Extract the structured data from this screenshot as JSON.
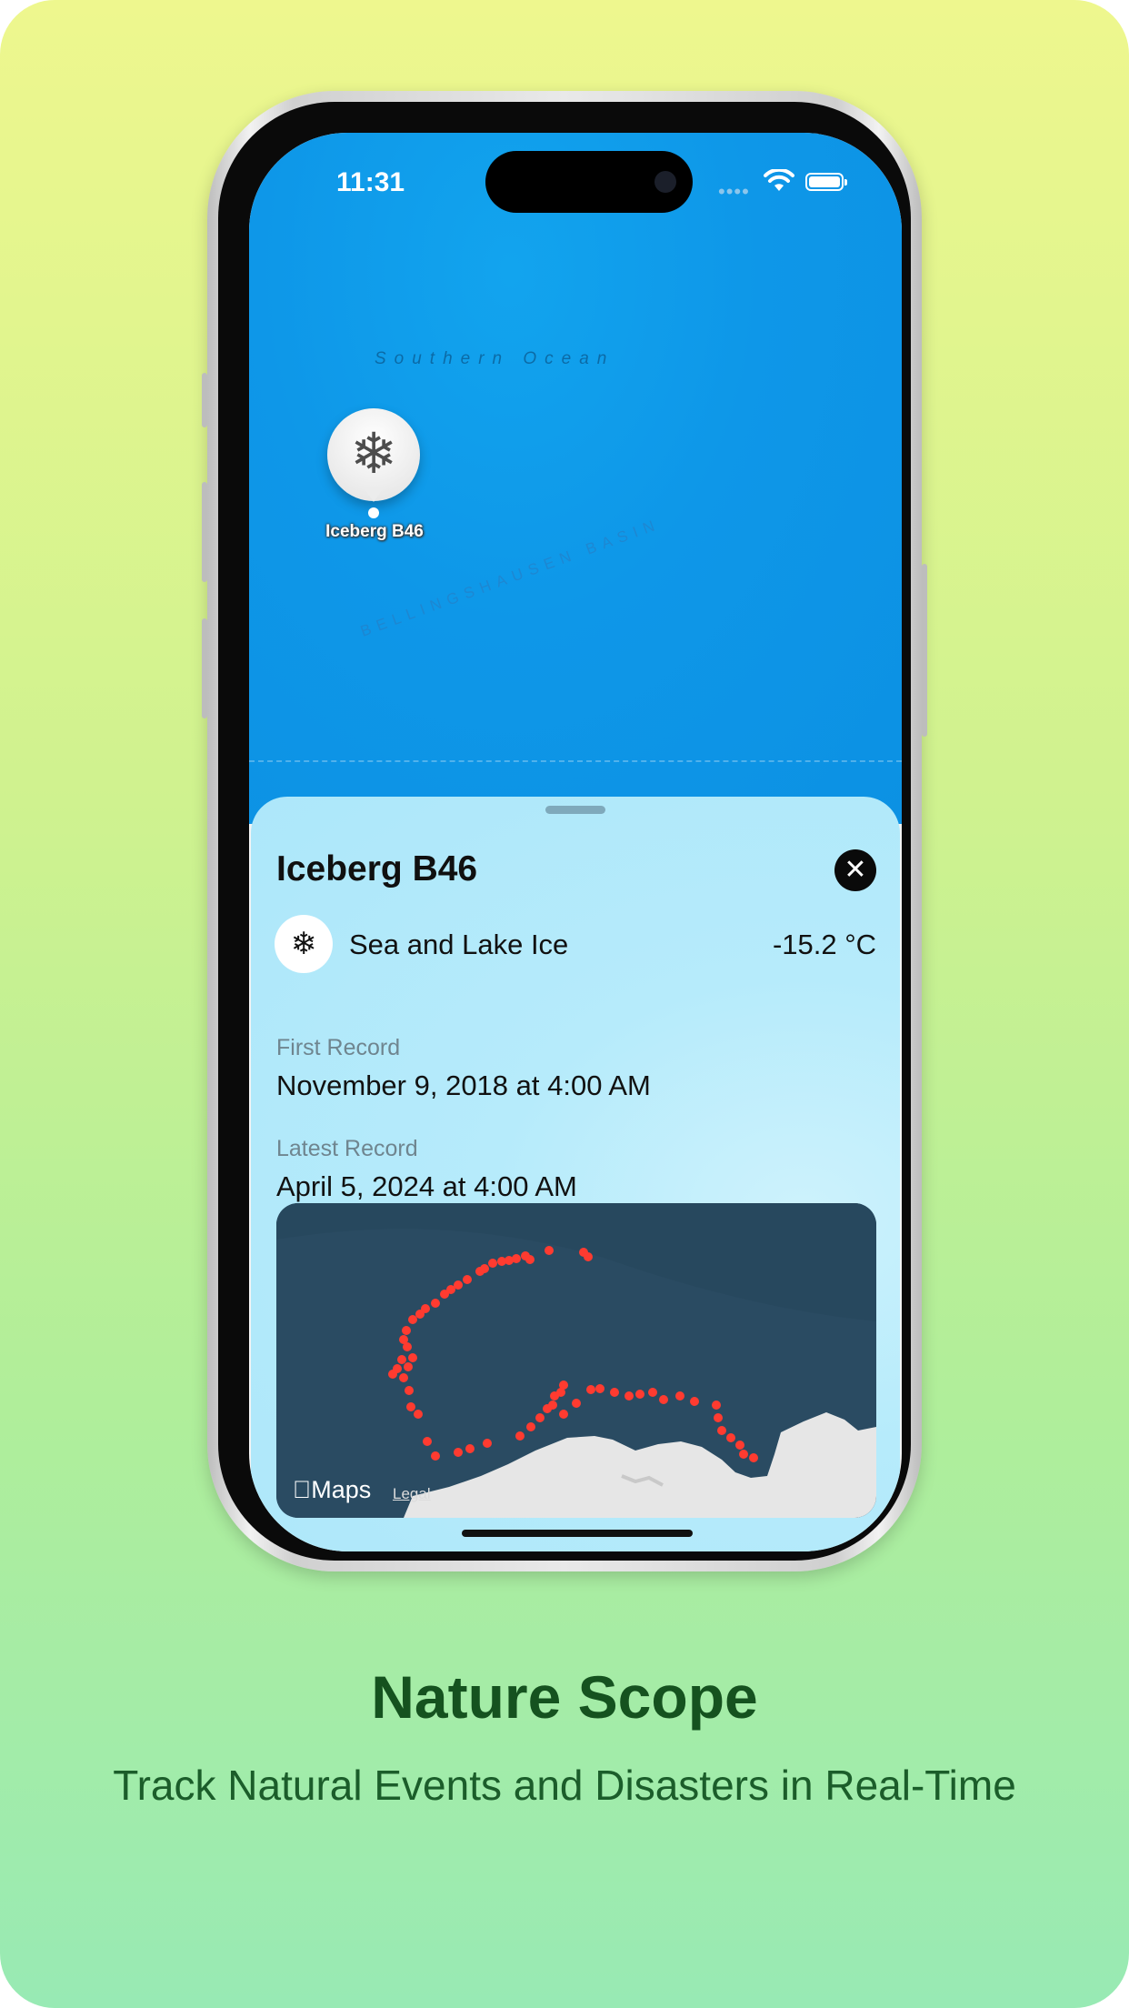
{
  "status_bar": {
    "time": "11:31"
  },
  "map": {
    "labels": {
      "ocean": "Southern Ocean",
      "basin": "BELLINGSHAUSEN BASIN"
    },
    "pin": {
      "icon": "snowflake-icon",
      "glyph": "❄",
      "label": "Iceberg B46"
    }
  },
  "sheet": {
    "title": "Iceberg B46",
    "close_glyph": "✕",
    "category": {
      "icon": "snowflake-icon",
      "glyph": "❄",
      "label": "Sea and Lake Ice"
    },
    "temperature": "-15.2 °C",
    "first_record": {
      "label": "First Record",
      "value": "November 9, 2018 at 4:00 AM"
    },
    "latest_record": {
      "label": "Latest Record",
      "value": "April 5, 2024 at 4:00 AM"
    },
    "minimap": {
      "brand": "Maps",
      "legal": "Legal",
      "track_color": "#ff3b30",
      "water_color": "#2a4b62",
      "land_color": "#e6e6e6"
    }
  },
  "caption": {
    "headline": "Nature Scope",
    "tagline": "Track Natural Events and Disasters in Real-Time"
  },
  "colors": {
    "map_water": "#0e97e8",
    "sheet_bg": "#b6ebfb",
    "headline": "#15521f",
    "poster_top": "#eef78e",
    "poster_bottom": "#98eab4"
  }
}
